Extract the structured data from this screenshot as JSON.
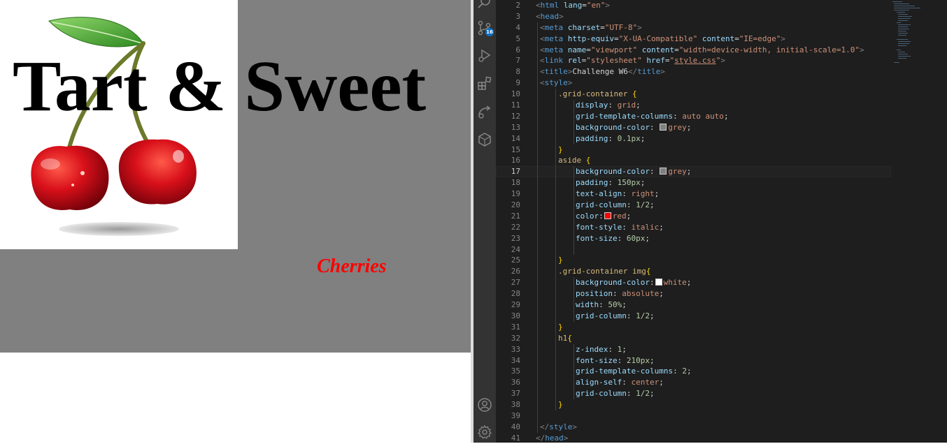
{
  "preview": {
    "heading": "Tart & Sweet",
    "aside_text": "Cherries",
    "image_alt": "cherries-image"
  },
  "colors": {
    "grid_bg": "#808080",
    "image_bg": "#ffffff",
    "aside_text": "#ff0000",
    "editor_bg": "#1e1e1e",
    "activity_bar_bg": "#333333"
  },
  "activity_bar": {
    "icons": [
      "search-icon",
      "source-control-icon",
      "run-debug-icon",
      "extensions-icon",
      "remote-explorer-icon",
      "docker-icon",
      "account-icon",
      "settings-gear-icon"
    ],
    "scm_badge": "16"
  },
  "editor": {
    "current_line": "17",
    "lines": [
      {
        "n": "2",
        "indent": 0,
        "tokens": [
          [
            "t-bracket",
            "<"
          ],
          [
            "t-tag",
            "html"
          ],
          [
            "t-text",
            " "
          ],
          [
            "t-attr",
            "lang"
          ],
          [
            "t-text",
            "="
          ],
          [
            "t-str",
            "\"en\""
          ],
          [
            "t-bracket",
            ">"
          ]
        ]
      },
      {
        "n": "3",
        "indent": 0,
        "tokens": [
          [
            "t-bracket",
            "<"
          ],
          [
            "t-tag",
            "head"
          ],
          [
            "t-bracket",
            ">"
          ]
        ]
      },
      {
        "n": "4",
        "indent": 1,
        "tokens": [
          [
            "t-bracket",
            "<"
          ],
          [
            "t-tag",
            "meta"
          ],
          [
            "t-text",
            " "
          ],
          [
            "t-attr",
            "charset"
          ],
          [
            "t-text",
            "="
          ],
          [
            "t-str",
            "\"UTF-8\""
          ],
          [
            "t-bracket",
            ">"
          ]
        ]
      },
      {
        "n": "5",
        "indent": 1,
        "tokens": [
          [
            "t-bracket",
            "<"
          ],
          [
            "t-tag",
            "meta"
          ],
          [
            "t-text",
            " "
          ],
          [
            "t-attr",
            "http-equiv"
          ],
          [
            "t-text",
            "="
          ],
          [
            "t-str",
            "\"X-UA-Compatible\""
          ],
          [
            "t-text",
            " "
          ],
          [
            "t-attr",
            "content"
          ],
          [
            "t-text",
            "="
          ],
          [
            "t-str",
            "\"IE=edge\""
          ],
          [
            "t-bracket",
            ">"
          ]
        ]
      },
      {
        "n": "6",
        "indent": 1,
        "tokens": [
          [
            "t-bracket",
            "<"
          ],
          [
            "t-tag",
            "meta"
          ],
          [
            "t-text",
            " "
          ],
          [
            "t-attr",
            "name"
          ],
          [
            "t-text",
            "="
          ],
          [
            "t-str",
            "\"viewport\""
          ],
          [
            "t-text",
            " "
          ],
          [
            "t-attr",
            "content"
          ],
          [
            "t-text",
            "="
          ],
          [
            "t-str",
            "\"width=device-width, initial-scale=1.0\""
          ],
          [
            "t-bracket",
            ">"
          ]
        ]
      },
      {
        "n": "7",
        "indent": 1,
        "tokens": [
          [
            "t-bracket",
            "<"
          ],
          [
            "t-tag",
            "link"
          ],
          [
            "t-text",
            " "
          ],
          [
            "t-attr",
            "rel"
          ],
          [
            "t-text",
            "="
          ],
          [
            "t-str",
            "\"stylesheet\""
          ],
          [
            "t-text",
            " "
          ],
          [
            "t-attr",
            "href"
          ],
          [
            "t-text",
            "="
          ],
          [
            "t-str",
            "\""
          ],
          [
            "t-str t-link",
            "style.css"
          ],
          [
            "t-str",
            "\""
          ],
          [
            "t-bracket",
            ">"
          ]
        ]
      },
      {
        "n": "8",
        "indent": 1,
        "tokens": [
          [
            "t-bracket",
            "<"
          ],
          [
            "t-tag",
            "title"
          ],
          [
            "t-bracket",
            ">"
          ],
          [
            "t-text",
            "Challenge W6"
          ],
          [
            "t-bracket",
            "</"
          ],
          [
            "t-tag",
            "title"
          ],
          [
            "t-bracket",
            ">"
          ]
        ]
      },
      {
        "n": "9",
        "indent": 1,
        "tokens": [
          [
            "t-bracket",
            "<"
          ],
          [
            "t-tag",
            "style"
          ],
          [
            "t-bracket",
            ">"
          ]
        ]
      },
      {
        "n": "10",
        "indent": 2,
        "tokens": [
          [
            "t-sel",
            ".grid-container"
          ],
          [
            "t-text",
            " "
          ],
          [
            "t-brace",
            "{"
          ]
        ]
      },
      {
        "n": "11",
        "indent": 3,
        "tokens": [
          [
            "t-prop",
            "display"
          ],
          [
            "t-punct",
            ": "
          ],
          [
            "t-val",
            "grid"
          ],
          [
            "t-punct",
            ";"
          ]
        ]
      },
      {
        "n": "12",
        "indent": 3,
        "tokens": [
          [
            "t-prop",
            "grid-template-columns"
          ],
          [
            "t-punct",
            ": "
          ],
          [
            "t-val",
            "auto auto"
          ],
          [
            "t-punct",
            ";"
          ]
        ]
      },
      {
        "n": "13",
        "indent": 3,
        "tokens": [
          [
            "t-prop",
            "background-color"
          ],
          [
            "t-punct",
            ": "
          ],
          [
            "swatch",
            "#808080"
          ],
          [
            "t-val",
            "grey"
          ],
          [
            "t-punct",
            ";"
          ]
        ]
      },
      {
        "n": "14",
        "indent": 3,
        "tokens": [
          [
            "t-prop",
            "padding"
          ],
          [
            "t-punct",
            ": "
          ],
          [
            "t-num",
            "0.1px"
          ],
          [
            "t-punct",
            ";"
          ]
        ]
      },
      {
        "n": "15",
        "indent": 2,
        "tokens": [
          [
            "t-brace",
            "}"
          ]
        ]
      },
      {
        "n": "16",
        "indent": 2,
        "tokens": [
          [
            "t-sel",
            "aside"
          ],
          [
            "t-text",
            " "
          ],
          [
            "t-brace",
            "{"
          ]
        ]
      },
      {
        "n": "17",
        "indent": 3,
        "tokens": [
          [
            "t-prop",
            "background-color"
          ],
          [
            "t-punct",
            ": "
          ],
          [
            "swatch",
            "#808080"
          ],
          [
            "t-val",
            "grey"
          ],
          [
            "t-punct",
            ";"
          ]
        ]
      },
      {
        "n": "18",
        "indent": 3,
        "tokens": [
          [
            "t-prop",
            "padding"
          ],
          [
            "t-punct",
            ": "
          ],
          [
            "t-num",
            "150px"
          ],
          [
            "t-punct",
            ";"
          ]
        ]
      },
      {
        "n": "19",
        "indent": 3,
        "tokens": [
          [
            "t-prop",
            "text-align"
          ],
          [
            "t-punct",
            ": "
          ],
          [
            "t-val",
            "right"
          ],
          [
            "t-punct",
            ";"
          ]
        ]
      },
      {
        "n": "20",
        "indent": 3,
        "tokens": [
          [
            "t-prop",
            "grid-column"
          ],
          [
            "t-punct",
            ": "
          ],
          [
            "t-num",
            "1/2"
          ],
          [
            "t-punct",
            ";"
          ]
        ]
      },
      {
        "n": "21",
        "indent": 3,
        "tokens": [
          [
            "t-prop",
            "color"
          ],
          [
            "t-punct",
            ":"
          ],
          [
            "swatch",
            "#ff0000"
          ],
          [
            "t-val",
            "red"
          ],
          [
            "t-punct",
            ";"
          ]
        ]
      },
      {
        "n": "22",
        "indent": 3,
        "tokens": [
          [
            "t-prop",
            "font-style"
          ],
          [
            "t-punct",
            ": "
          ],
          [
            "t-val",
            "italic"
          ],
          [
            "t-punct",
            ";"
          ]
        ]
      },
      {
        "n": "23",
        "indent": 3,
        "tokens": [
          [
            "t-prop",
            "font-size"
          ],
          [
            "t-punct",
            ": "
          ],
          [
            "t-num",
            "60px"
          ],
          [
            "t-punct",
            ";"
          ]
        ]
      },
      {
        "n": "24",
        "indent": 3,
        "tokens": []
      },
      {
        "n": "25",
        "indent": 2,
        "tokens": [
          [
            "t-brace",
            "}"
          ]
        ]
      },
      {
        "n": "26",
        "indent": 2,
        "tokens": [
          [
            "t-sel",
            ".grid-container img"
          ],
          [
            "t-brace",
            "{"
          ]
        ]
      },
      {
        "n": "27",
        "indent": 3,
        "tokens": [
          [
            "t-prop",
            "background-color"
          ],
          [
            "t-punct",
            ":"
          ],
          [
            "swatch",
            "#ffffff"
          ],
          [
            "t-val",
            "white"
          ],
          [
            "t-punct",
            ";"
          ]
        ]
      },
      {
        "n": "28",
        "indent": 3,
        "tokens": [
          [
            "t-prop",
            "position"
          ],
          [
            "t-punct",
            ": "
          ],
          [
            "t-val",
            "absolute"
          ],
          [
            "t-punct",
            ";"
          ]
        ]
      },
      {
        "n": "29",
        "indent": 3,
        "tokens": [
          [
            "t-prop",
            "width"
          ],
          [
            "t-punct",
            ": "
          ],
          [
            "t-num",
            "50%"
          ],
          [
            "t-punct",
            ";"
          ]
        ]
      },
      {
        "n": "30",
        "indent": 3,
        "tokens": [
          [
            "t-prop",
            "grid-column"
          ],
          [
            "t-punct",
            ": "
          ],
          [
            "t-num",
            "1/2"
          ],
          [
            "t-punct",
            ";"
          ]
        ]
      },
      {
        "n": "31",
        "indent": 2,
        "tokens": [
          [
            "t-brace",
            "}"
          ]
        ]
      },
      {
        "n": "32",
        "indent": 2,
        "tokens": [
          [
            "t-sel",
            "h1"
          ],
          [
            "t-brace",
            "{"
          ]
        ]
      },
      {
        "n": "33",
        "indent": 3,
        "tokens": [
          [
            "t-prop",
            "z-index"
          ],
          [
            "t-punct",
            ": "
          ],
          [
            "t-num",
            "1"
          ],
          [
            "t-punct",
            ";"
          ]
        ]
      },
      {
        "n": "34",
        "indent": 3,
        "tokens": [
          [
            "t-prop",
            "font-size"
          ],
          [
            "t-punct",
            ": "
          ],
          [
            "t-num",
            "210px"
          ],
          [
            "t-punct",
            ";"
          ]
        ]
      },
      {
        "n": "35",
        "indent": 3,
        "tokens": [
          [
            "t-prop",
            "grid-template-columns"
          ],
          [
            "t-punct",
            ": "
          ],
          [
            "t-num",
            "2"
          ],
          [
            "t-punct",
            ";"
          ]
        ]
      },
      {
        "n": "36",
        "indent": 3,
        "tokens": [
          [
            "t-prop",
            "align-self"
          ],
          [
            "t-punct",
            ": "
          ],
          [
            "t-val",
            "center"
          ],
          [
            "t-punct",
            ";"
          ]
        ]
      },
      {
        "n": "37",
        "indent": 3,
        "tokens": [
          [
            "t-prop",
            "grid-column"
          ],
          [
            "t-punct",
            ": "
          ],
          [
            "t-num",
            "1/2"
          ],
          [
            "t-punct",
            ";"
          ]
        ]
      },
      {
        "n": "38",
        "indent": 2,
        "tokens": [
          [
            "t-brace",
            "}"
          ]
        ]
      },
      {
        "n": "39",
        "indent": 1,
        "tokens": []
      },
      {
        "n": "40",
        "indent": 1,
        "tokens": [
          [
            "t-bracket",
            "</"
          ],
          [
            "t-tag",
            "style"
          ],
          [
            "t-bracket",
            ">"
          ]
        ]
      },
      {
        "n": "41",
        "indent": 0,
        "tokens": [
          [
            "t-bracket",
            "</"
          ],
          [
            "t-tag",
            "head"
          ],
          [
            "t-bracket",
            ">"
          ]
        ]
      }
    ]
  }
}
